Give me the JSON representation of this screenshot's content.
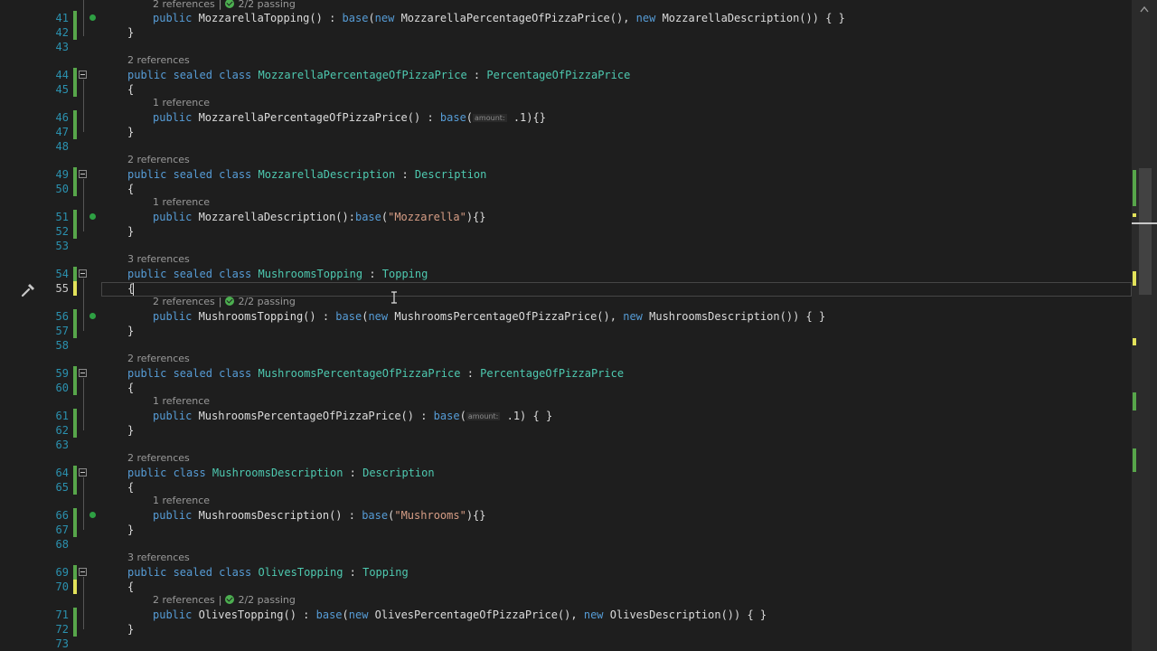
{
  "editor": {
    "lines": [
      {
        "n": "41",
        "indent": 2,
        "marker": "saved",
        "dot": true,
        "parts": [
          {
            "t": "public ",
            "c": "kw"
          },
          {
            "t": "MozzarellaTopping() : "
          },
          {
            "t": "base",
            "c": "kw"
          },
          {
            "t": "("
          },
          {
            "t": "new ",
            "c": "kw"
          },
          {
            "t": "MozzarellaPercentageOfPizzaPrice(), "
          },
          {
            "t": "new ",
            "c": "kw"
          },
          {
            "t": "MozzarellaDescription()) { }"
          }
        ]
      },
      {
        "n": "42",
        "indent": 1,
        "marker": "saved",
        "parts": [
          {
            "t": "}"
          }
        ]
      },
      {
        "n": "43",
        "indent": 0,
        "parts": []
      },
      {
        "n": "44",
        "indent": 1,
        "marker": "saved",
        "fold": true,
        "lens": {
          "refs": "2 references"
        },
        "parts": [
          {
            "t": "public sealed class ",
            "c": "kw"
          },
          {
            "t": "MozzarellaPercentageOfPizzaPrice",
            "c": "ty"
          },
          {
            "t": " : "
          },
          {
            "t": "PercentageOfPizzaPrice",
            "c": "ty"
          }
        ]
      },
      {
        "n": "45",
        "indent": 1,
        "marker": "saved",
        "parts": [
          {
            "t": "{"
          }
        ]
      },
      {
        "n": "46",
        "indent": 2,
        "marker": "saved",
        "lens": {
          "refs": "1 reference"
        },
        "parts": [
          {
            "t": "public ",
            "c": "kw"
          },
          {
            "t": "MozzarellaPercentageOfPizzaPrice() : "
          },
          {
            "t": "base",
            "c": "kw"
          },
          {
            "t": "("
          },
          {
            "h": "amount:"
          },
          {
            "t": " .1){}"
          }
        ]
      },
      {
        "n": "47",
        "indent": 1,
        "marker": "saved",
        "parts": [
          {
            "t": "}"
          }
        ]
      },
      {
        "n": "48",
        "indent": 0,
        "parts": []
      },
      {
        "n": "49",
        "indent": 1,
        "marker": "saved",
        "fold": true,
        "lens": {
          "refs": "2 references"
        },
        "parts": [
          {
            "t": "public sealed class ",
            "c": "kw"
          },
          {
            "t": "MozzarellaDescription",
            "c": "ty"
          },
          {
            "t": " : "
          },
          {
            "t": "Description",
            "c": "ty"
          }
        ]
      },
      {
        "n": "50",
        "indent": 1,
        "marker": "saved",
        "parts": [
          {
            "t": "{"
          }
        ]
      },
      {
        "n": "51",
        "indent": 2,
        "marker": "saved",
        "dot": true,
        "lens": {
          "refs": "1 reference"
        },
        "parts": [
          {
            "t": "public ",
            "c": "kw"
          },
          {
            "t": "MozzarellaDescription():"
          },
          {
            "t": "base",
            "c": "kw"
          },
          {
            "t": "("
          },
          {
            "t": "\"Mozzarella\"",
            "c": "str"
          },
          {
            "t": "){}"
          }
        ]
      },
      {
        "n": "52",
        "indent": 1,
        "marker": "saved",
        "parts": [
          {
            "t": "}"
          }
        ]
      },
      {
        "n": "53",
        "indent": 0,
        "parts": []
      },
      {
        "n": "54",
        "indent": 1,
        "marker": "saved",
        "fold": true,
        "lens": {
          "refs": "3 references"
        },
        "parts": [
          {
            "t": "public sealed class ",
            "c": "kw"
          },
          {
            "t": "MushroomsTopping",
            "c": "ty"
          },
          {
            "t": " : "
          },
          {
            "t": "Topping",
            "c": "ty"
          }
        ]
      },
      {
        "n": "55",
        "indent": 1,
        "marker": "unsaved",
        "current": true,
        "parts": [
          {
            "t": "{"
          }
        ]
      },
      {
        "n": "56",
        "indent": 2,
        "marker": "saved",
        "dot": true,
        "lens": {
          "refs": "2 references",
          "tests": "2/2 passing"
        },
        "parts": [
          {
            "t": "public ",
            "c": "kw"
          },
          {
            "t": "MushroomsTopping() : "
          },
          {
            "t": "base",
            "c": "kw"
          },
          {
            "t": "("
          },
          {
            "t": "new ",
            "c": "kw"
          },
          {
            "t": "MushroomsPercentageOfPizzaPrice(), "
          },
          {
            "t": "new ",
            "c": "kw"
          },
          {
            "t": "MushroomsDescription()) { }"
          }
        ]
      },
      {
        "n": "57",
        "indent": 1,
        "marker": "saved",
        "parts": [
          {
            "t": "}"
          }
        ]
      },
      {
        "n": "58",
        "indent": 0,
        "parts": []
      },
      {
        "n": "59",
        "indent": 1,
        "marker": "saved",
        "fold": true,
        "lens": {
          "refs": "2 references"
        },
        "parts": [
          {
            "t": "public sealed class ",
            "c": "kw"
          },
          {
            "t": "MushroomsPercentageOfPizzaPrice",
            "c": "ty"
          },
          {
            "t": " : "
          },
          {
            "t": "PercentageOfPizzaPrice",
            "c": "ty"
          }
        ]
      },
      {
        "n": "60",
        "indent": 1,
        "marker": "saved",
        "parts": [
          {
            "t": "{"
          }
        ]
      },
      {
        "n": "61",
        "indent": 2,
        "marker": "saved",
        "lens": {
          "refs": "1 reference"
        },
        "parts": [
          {
            "t": "public ",
            "c": "kw"
          },
          {
            "t": "MushroomsPercentageOfPizzaPrice() : "
          },
          {
            "t": "base",
            "c": "kw"
          },
          {
            "t": "("
          },
          {
            "h": "amount:"
          },
          {
            "t": " .1) { }"
          }
        ]
      },
      {
        "n": "62",
        "indent": 1,
        "marker": "saved",
        "parts": [
          {
            "t": "}"
          }
        ]
      },
      {
        "n": "63",
        "indent": 0,
        "parts": []
      },
      {
        "n": "64",
        "indent": 1,
        "marker": "saved",
        "fold": true,
        "lens": {
          "refs": "2 references"
        },
        "parts": [
          {
            "t": "public class ",
            "c": "kw"
          },
          {
            "t": "MushroomsDescription",
            "c": "ty"
          },
          {
            "t": " : "
          },
          {
            "t": "Description",
            "c": "ty"
          }
        ]
      },
      {
        "n": "65",
        "indent": 1,
        "marker": "saved",
        "parts": [
          {
            "t": "{"
          }
        ]
      },
      {
        "n": "66",
        "indent": 2,
        "marker": "saved",
        "dot": true,
        "lens": {
          "refs": "1 reference"
        },
        "parts": [
          {
            "t": "public ",
            "c": "kw"
          },
          {
            "t": "MushroomsDescription() : "
          },
          {
            "t": "base",
            "c": "kw"
          },
          {
            "t": "("
          },
          {
            "t": "\"Mushrooms\"",
            "c": "str"
          },
          {
            "t": "){}"
          }
        ]
      },
      {
        "n": "67",
        "indent": 1,
        "marker": "saved",
        "parts": [
          {
            "t": "}"
          }
        ]
      },
      {
        "n": "68",
        "indent": 0,
        "parts": []
      },
      {
        "n": "69",
        "indent": 1,
        "marker": "saved",
        "fold": true,
        "lens": {
          "refs": "3 references"
        },
        "parts": [
          {
            "t": "public sealed class ",
            "c": "kw"
          },
          {
            "t": "OlivesTopping",
            "c": "ty"
          },
          {
            "t": " : "
          },
          {
            "t": "Topping",
            "c": "ty"
          }
        ]
      },
      {
        "n": "70",
        "indent": 1,
        "marker": "unsaved",
        "parts": [
          {
            "t": "{"
          }
        ]
      },
      {
        "n": "71",
        "indent": 2,
        "marker": "saved",
        "lens": {
          "refs": "2 references",
          "tests": "2/2 passing"
        },
        "parts": [
          {
            "t": "public ",
            "c": "kw"
          },
          {
            "t": "OlivesTopping() : "
          },
          {
            "t": "base",
            "c": "kw"
          },
          {
            "t": "("
          },
          {
            "t": "new ",
            "c": "kw"
          },
          {
            "t": "OlivesPercentageOfPizzaPrice(), "
          },
          {
            "t": "new ",
            "c": "kw"
          },
          {
            "t": "OlivesDescription()) { }"
          }
        ]
      },
      {
        "n": "72",
        "indent": 1,
        "marker": "saved",
        "parts": [
          {
            "t": "}"
          }
        ]
      },
      {
        "n": "73",
        "indent": 0,
        "parts": []
      }
    ],
    "top_lens": {
      "refs": "2 references",
      "tests": "2/2 passing"
    }
  },
  "colors": {
    "background": "#1e1e1e",
    "keyword": "#569cd6",
    "type": "#4ec9b0",
    "string": "#d69d85",
    "line_number": "#2b91af",
    "saved_marker": "#57a64a",
    "unsaved_marker": "#e2e25a"
  },
  "icons": {
    "quick_actions": "wrench-icon",
    "test_status": "check-circle-icon",
    "scroll_up": "chevron-up-icon"
  }
}
